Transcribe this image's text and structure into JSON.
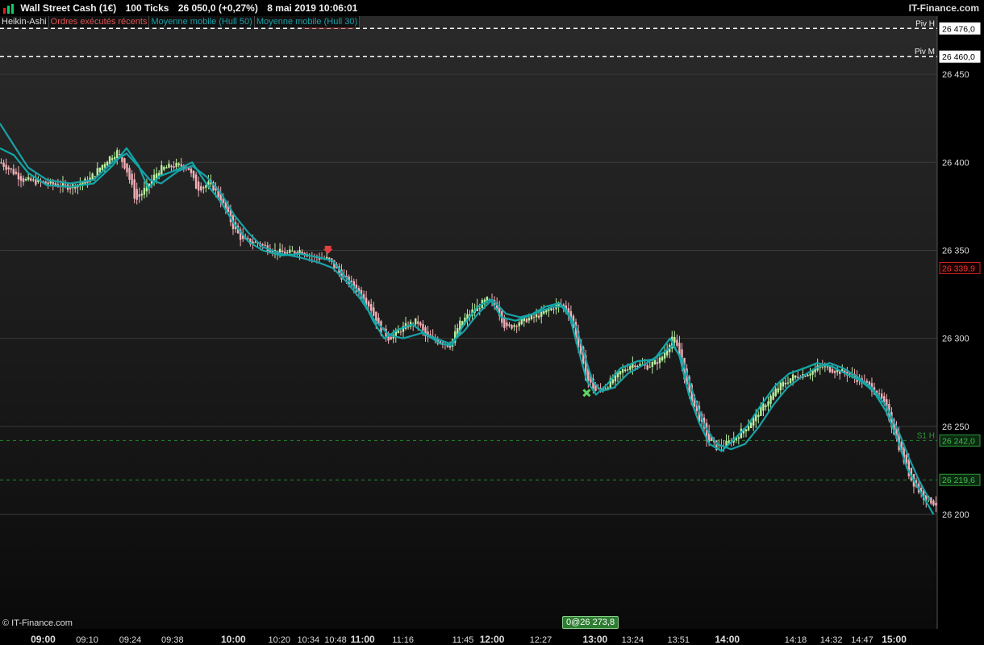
{
  "header": {
    "instrument": "Wall Street Cash (1€)",
    "timeframe": "100 Ticks",
    "quote": "26 050,0 (+0,27%)",
    "datetime": "8 mai 2019 10:06:01",
    "brand": "IT-Finance.com"
  },
  "legend": {
    "items": [
      "Heikin-Ashi",
      "Ordres exécutés récents",
      "Moyenne mobile (Hull 50)",
      "Moyenne mobile (Hull 30)"
    ],
    "colors": [
      "#dddddd",
      "#e05555",
      "#18a0a8",
      "#18a0a8"
    ]
  },
  "footer": {
    "copyright": "© IT-Finance.com",
    "order_tag": "0@26 273,8"
  },
  "chart_data": {
    "type": "line",
    "title": "",
    "ylim": [
      26135,
      26483
    ],
    "yticks": [
      26200,
      26250,
      26300,
      26350,
      26400,
      26450
    ],
    "ytick_labels": [
      "26 200",
      "26 250",
      "26 300",
      "26 350",
      "26 400",
      "26 450"
    ],
    "xticks": [
      {
        "label": "09:00",
        "major": true,
        "pos": 0.046
      },
      {
        "label": "09:10",
        "major": false,
        "pos": 0.093
      },
      {
        "label": "09:24",
        "major": false,
        "pos": 0.139
      },
      {
        "label": "09:38",
        "major": false,
        "pos": 0.184
      },
      {
        "label": "10:00",
        "major": true,
        "pos": 0.249
      },
      {
        "label": "10:20",
        "major": false,
        "pos": 0.298
      },
      {
        "label": "10:34",
        "major": false,
        "pos": 0.329
      },
      {
        "label": "10:48",
        "major": false,
        "pos": 0.358
      },
      {
        "label": "11:00",
        "major": true,
        "pos": 0.387
      },
      {
        "label": "11:16",
        "major": false,
        "pos": 0.43
      },
      {
        "label": "11:45",
        "major": false,
        "pos": 0.494
      },
      {
        "label": "12:00",
        "major": true,
        "pos": 0.525
      },
      {
        "label": "12:27",
        "major": false,
        "pos": 0.577
      },
      {
        "label": "13:00",
        "major": true,
        "pos": 0.635
      },
      {
        "label": "13:24",
        "major": false,
        "pos": 0.675
      },
      {
        "label": "13:51",
        "major": false,
        "pos": 0.724
      },
      {
        "label": "14:00",
        "major": true,
        "pos": 0.776
      },
      {
        "label": "14:18",
        "major": false,
        "pos": 0.849
      },
      {
        "label": "14:32",
        "major": false,
        "pos": 0.887
      },
      {
        "label": "14:47",
        "major": false,
        "pos": 0.92
      },
      {
        "label": "15:00",
        "major": true,
        "pos": 0.954
      }
    ],
    "levels": [
      {
        "name": "Piv H",
        "value": 26476.0,
        "label": "26 476,0",
        "style": "dashed",
        "color": "#ffffff"
      },
      {
        "name": "Piv M",
        "value": 26460.0,
        "label": "26 460,0",
        "style": "dashed",
        "color": "#ffffff"
      },
      {
        "name": "S1 H",
        "value": 26242.0,
        "label": "26 242,0",
        "style": "dashed",
        "color": "#1f8a2a"
      },
      {
        "name": "",
        "value": 26219.6,
        "label": "26 219,6",
        "style": "dashed",
        "color": "#1f8a2a"
      }
    ],
    "last_price": {
      "value": 26339.9,
      "label": "26 339,9",
      "color": "#cc2222"
    },
    "price_path": [
      [
        0.0,
        26400
      ],
      [
        0.025,
        26390
      ],
      [
        0.05,
        26388
      ],
      [
        0.075,
        26386
      ],
      [
        0.095,
        26390
      ],
      [
        0.115,
        26402
      ],
      [
        0.125,
        26406
      ],
      [
        0.135,
        26396
      ],
      [
        0.145,
        26378
      ],
      [
        0.155,
        26385
      ],
      [
        0.17,
        26396
      ],
      [
        0.185,
        26398
      ],
      [
        0.2,
        26398
      ],
      [
        0.21,
        26385
      ],
      [
        0.225,
        26388
      ],
      [
        0.24,
        26374
      ],
      [
        0.25,
        26362
      ],
      [
        0.26,
        26355
      ],
      [
        0.275,
        26354
      ],
      [
        0.29,
        26350
      ],
      [
        0.305,
        26348
      ],
      [
        0.32,
        26350
      ],
      [
        0.335,
        26346
      ],
      [
        0.35,
        26345
      ],
      [
        0.365,
        26335
      ],
      [
        0.38,
        26328
      ],
      [
        0.395,
        26318
      ],
      [
        0.405,
        26305
      ],
      [
        0.415,
        26300
      ],
      [
        0.43,
        26306
      ],
      [
        0.445,
        26310
      ],
      [
        0.455,
        26300
      ],
      [
        0.47,
        26298
      ],
      [
        0.48,
        26296
      ],
      [
        0.49,
        26308
      ],
      [
        0.505,
        26316
      ],
      [
        0.52,
        26322
      ],
      [
        0.53,
        26318
      ],
      [
        0.54,
        26305
      ],
      [
        0.555,
        26310
      ],
      [
        0.57,
        26312
      ],
      [
        0.585,
        26316
      ],
      [
        0.597,
        26320
      ],
      [
        0.607,
        26315
      ],
      [
        0.617,
        26295
      ],
      [
        0.625,
        26278
      ],
      [
        0.635,
        26270
      ],
      [
        0.645,
        26272
      ],
      [
        0.66,
        26280
      ],
      [
        0.675,
        26286
      ],
      [
        0.69,
        26284
      ],
      [
        0.705,
        26288
      ],
      [
        0.718,
        26302
      ],
      [
        0.725,
        26290
      ],
      [
        0.735,
        26268
      ],
      [
        0.745,
        26256
      ],
      [
        0.755,
        26242
      ],
      [
        0.765,
        26238
      ],
      [
        0.775,
        26240
      ],
      [
        0.785,
        26244
      ],
      [
        0.8,
        26252
      ],
      [
        0.815,
        26262
      ],
      [
        0.83,
        26272
      ],
      [
        0.845,
        26278
      ],
      [
        0.86,
        26280
      ],
      [
        0.875,
        26284
      ],
      [
        0.89,
        26282
      ],
      [
        0.905,
        26280
      ],
      [
        0.918,
        26276
      ],
      [
        0.93,
        26272
      ],
      [
        0.942,
        26264
      ],
      [
        0.952,
        26250
      ],
      [
        0.962,
        26234
      ],
      [
        0.972,
        26220
      ],
      [
        0.985,
        26210
      ],
      [
        0.998,
        26206
      ]
    ],
    "series": [
      {
        "name": "Moyenne mobile (Hull 50)",
        "color": "#1aa0a6",
        "points": [
          [
            0.0,
            26422
          ],
          [
            0.012,
            26412
          ],
          [
            0.03,
            26397
          ],
          [
            0.05,
            26390
          ],
          [
            0.075,
            26388
          ],
          [
            0.1,
            26390
          ],
          [
            0.12,
            26400
          ],
          [
            0.135,
            26405
          ],
          [
            0.147,
            26398
          ],
          [
            0.16,
            26390
          ],
          [
            0.172,
            26388
          ],
          [
            0.19,
            26395
          ],
          [
            0.205,
            26398
          ],
          [
            0.22,
            26392
          ],
          [
            0.235,
            26383
          ],
          [
            0.25,
            26370
          ],
          [
            0.265,
            26360
          ],
          [
            0.28,
            26352
          ],
          [
            0.3,
            26348
          ],
          [
            0.32,
            26346
          ],
          [
            0.34,
            26343
          ],
          [
            0.355,
            26340
          ],
          [
            0.37,
            26332
          ],
          [
            0.385,
            26322
          ],
          [
            0.4,
            26310
          ],
          [
            0.415,
            26302
          ],
          [
            0.43,
            26300
          ],
          [
            0.45,
            26303
          ],
          [
            0.465,
            26300
          ],
          [
            0.48,
            26297
          ],
          [
            0.495,
            26304
          ],
          [
            0.51,
            26314
          ],
          [
            0.525,
            26322
          ],
          [
            0.54,
            26314
          ],
          [
            0.555,
            26312
          ],
          [
            0.57,
            26314
          ],
          [
            0.59,
            26318
          ],
          [
            0.602,
            26318
          ],
          [
            0.615,
            26306
          ],
          [
            0.625,
            26288
          ],
          [
            0.632,
            26276
          ],
          [
            0.642,
            26270
          ],
          [
            0.655,
            26272
          ],
          [
            0.67,
            26280
          ],
          [
            0.69,
            26286
          ],
          [
            0.708,
            26292
          ],
          [
            0.718,
            26296
          ],
          [
            0.728,
            26288
          ],
          [
            0.74,
            26268
          ],
          [
            0.752,
            26250
          ],
          [
            0.765,
            26240
          ],
          [
            0.78,
            26237
          ],
          [
            0.795,
            26240
          ],
          [
            0.81,
            26250
          ],
          [
            0.825,
            26262
          ],
          [
            0.84,
            26272
          ],
          [
            0.855,
            26278
          ],
          [
            0.87,
            26283
          ],
          [
            0.885,
            26286
          ],
          [
            0.9,
            26283
          ],
          [
            0.915,
            26278
          ],
          [
            0.93,
            26272
          ],
          [
            0.945,
            26262
          ],
          [
            0.958,
            26248
          ],
          [
            0.97,
            26232
          ],
          [
            0.98,
            26220
          ],
          [
            0.992,
            26208
          ]
        ]
      },
      {
        "name": "Moyenne mobile (Hull 30)",
        "color": "#10a8a8",
        "points": [
          [
            0.0,
            26408
          ],
          [
            0.015,
            26404
          ],
          [
            0.03,
            26394
          ],
          [
            0.05,
            26387
          ],
          [
            0.075,
            26386
          ],
          [
            0.1,
            26388
          ],
          [
            0.12,
            26398
          ],
          [
            0.135,
            26408
          ],
          [
            0.148,
            26398
          ],
          [
            0.158,
            26385
          ],
          [
            0.17,
            26392
          ],
          [
            0.19,
            26396
          ],
          [
            0.205,
            26400
          ],
          [
            0.22,
            26388
          ],
          [
            0.235,
            26378
          ],
          [
            0.25,
            26365
          ],
          [
            0.265,
            26355
          ],
          [
            0.28,
            26350
          ],
          [
            0.3,
            26347
          ],
          [
            0.32,
            26348
          ],
          [
            0.34,
            26346
          ],
          [
            0.355,
            26344
          ],
          [
            0.37,
            26334
          ],
          [
            0.385,
            26325
          ],
          [
            0.398,
            26310
          ],
          [
            0.41,
            26300
          ],
          [
            0.425,
            26305
          ],
          [
            0.44,
            26308
          ],
          [
            0.455,
            26302
          ],
          [
            0.47,
            26297
          ],
          [
            0.482,
            26296
          ],
          [
            0.495,
            26308
          ],
          [
            0.51,
            26318
          ],
          [
            0.523,
            26322
          ],
          [
            0.535,
            26312
          ],
          [
            0.55,
            26310
          ],
          [
            0.565,
            26313
          ],
          [
            0.582,
            26318
          ],
          [
            0.597,
            26320
          ],
          [
            0.608,
            26312
          ],
          [
            0.618,
            26292
          ],
          [
            0.626,
            26276
          ],
          [
            0.636,
            26268
          ],
          [
            0.648,
            26274
          ],
          [
            0.662,
            26283
          ],
          [
            0.68,
            26287
          ],
          [
            0.698,
            26288
          ],
          [
            0.715,
            26300
          ],
          [
            0.725,
            26290
          ],
          [
            0.735,
            26268
          ],
          [
            0.746,
            26252
          ],
          [
            0.757,
            26240
          ],
          [
            0.77,
            26236
          ],
          [
            0.782,
            26242
          ],
          [
            0.797,
            26250
          ],
          [
            0.812,
            26262
          ],
          [
            0.827,
            26273
          ],
          [
            0.842,
            26280
          ],
          [
            0.858,
            26283
          ],
          [
            0.872,
            26286
          ],
          [
            0.888,
            26284
          ],
          [
            0.902,
            26280
          ],
          [
            0.918,
            26276
          ],
          [
            0.932,
            26270
          ],
          [
            0.946,
            26258
          ],
          [
            0.958,
            26242
          ],
          [
            0.968,
            26226
          ],
          [
            0.982,
            26213
          ],
          [
            0.996,
            26200
          ]
        ]
      }
    ],
    "markers": [
      {
        "type": "sell-arrow",
        "x": 0.35,
        "y": 26348,
        "color": "#e04040"
      },
      {
        "type": "buy-cross",
        "x": 0.626,
        "y": 26269,
        "color": "#5fd55f"
      }
    ]
  }
}
